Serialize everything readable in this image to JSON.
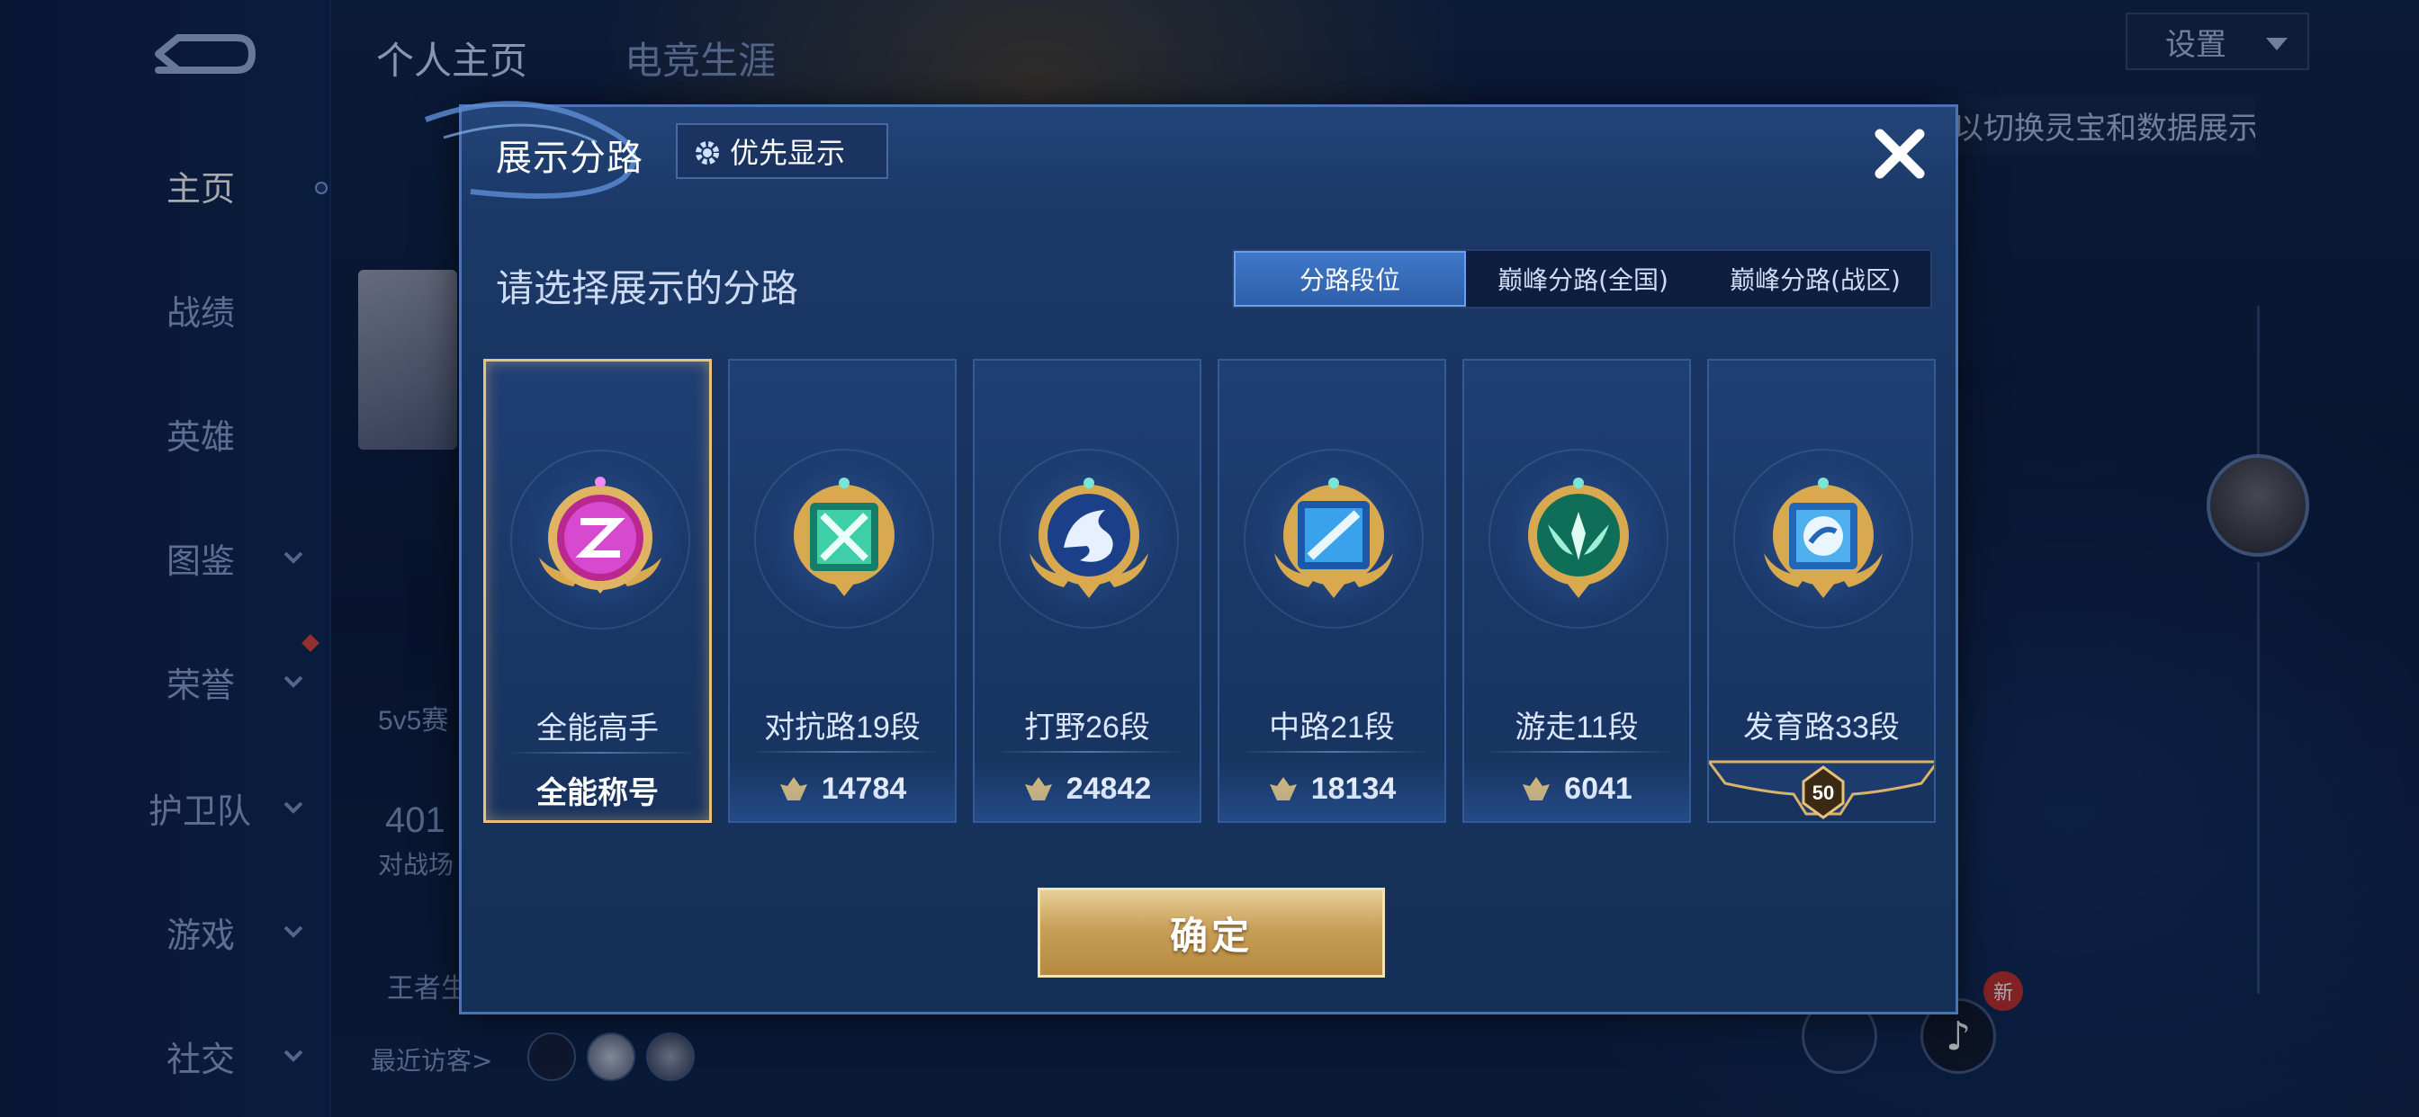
{
  "top_tabs": {
    "profile": "个人主页",
    "career": "电竞生涯"
  },
  "settings": {
    "label": "设置"
  },
  "tooltip": {
    "text": "以切换灵宝和数据展示"
  },
  "sidebar": {
    "items": [
      {
        "label": "主页"
      },
      {
        "label": "战绩"
      },
      {
        "label": "英雄"
      },
      {
        "label": "图鉴"
      },
      {
        "label": "荣誉"
      },
      {
        "label": "护卫队"
      },
      {
        "label": "游戏"
      },
      {
        "label": "社交"
      }
    ]
  },
  "background": {
    "mode_text": "5v5赛",
    "count": "401",
    "count_label": "对战场",
    "king_text": "王者生",
    "recent_visitors": "最近访客>"
  },
  "modal": {
    "title": "展示分路",
    "priority_label": "优先显示",
    "subtitle": "请选择展示的分路",
    "tabs": [
      {
        "label": "分路段位",
        "active": true
      },
      {
        "label": "巅峰分路(全国)",
        "active": false
      },
      {
        "label": "巅峰分路(战区)",
        "active": false
      }
    ],
    "cards": [
      {
        "name": "全能高手",
        "value": "全能称号",
        "selected": true,
        "icon": "all-round-badge-icon",
        "accent": "#c63bc9"
      },
      {
        "name": "对抗路19段",
        "value": "14784",
        "icon": "clash-lane-badge-icon",
        "accent": "#2fb59a"
      },
      {
        "name": "打野26段",
        "value": "24842",
        "icon": "jungle-badge-icon",
        "accent": "#2b5fc7"
      },
      {
        "name": "中路21段",
        "value": "18134",
        "icon": "mid-lane-badge-icon",
        "accent": "#2d8fd8"
      },
      {
        "name": "游走11段",
        "value": "6041",
        "icon": "roam-badge-icon",
        "accent": "#1f9c7a"
      },
      {
        "name": "发育路33段",
        "value": "50",
        "icon": "farm-lane-badge-icon",
        "accent": "#3a8fe0"
      }
    ],
    "confirm_label": "确定"
  },
  "bottom": {
    "new_badge": "新"
  }
}
